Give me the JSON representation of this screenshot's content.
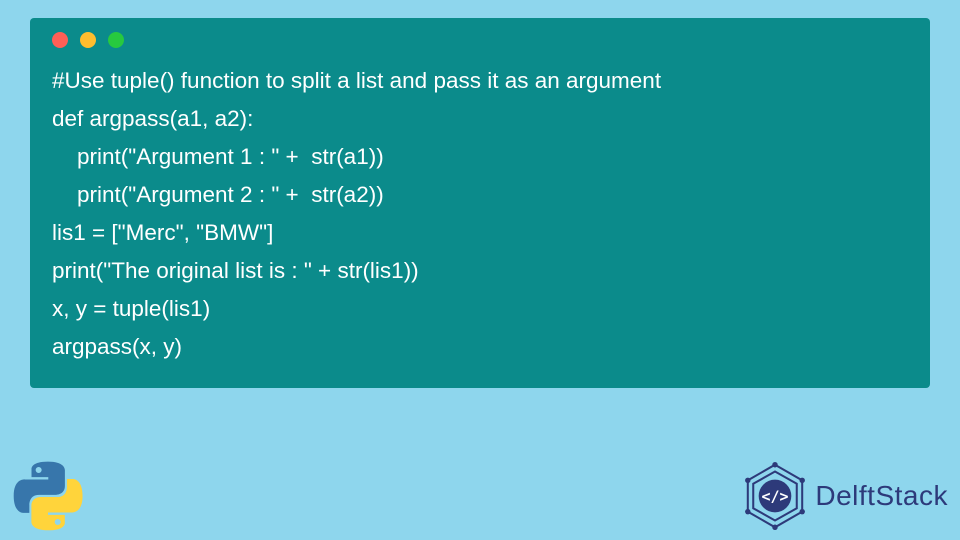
{
  "code": {
    "line1": "#Use tuple() function to split a list and pass it as an argument",
    "line2": "def argpass(a1, a2):",
    "line3": "    print(\"Argument 1 : \" +  str(a1))",
    "line4": "    print(\"Argument 2 : \" +  str(a2))",
    "line5": "lis1 = [\"Merc\", \"BMW\"]",
    "line6": "print(\"The original list is : \" + str(lis1))",
    "line7": "x, y = tuple(lis1)",
    "line8": "argpass(x, y)"
  },
  "brand": {
    "name": "DelftStack"
  },
  "colors": {
    "background": "#8ed6ed",
    "window": "#0b8b8b",
    "brand": "#2d3a7a"
  }
}
